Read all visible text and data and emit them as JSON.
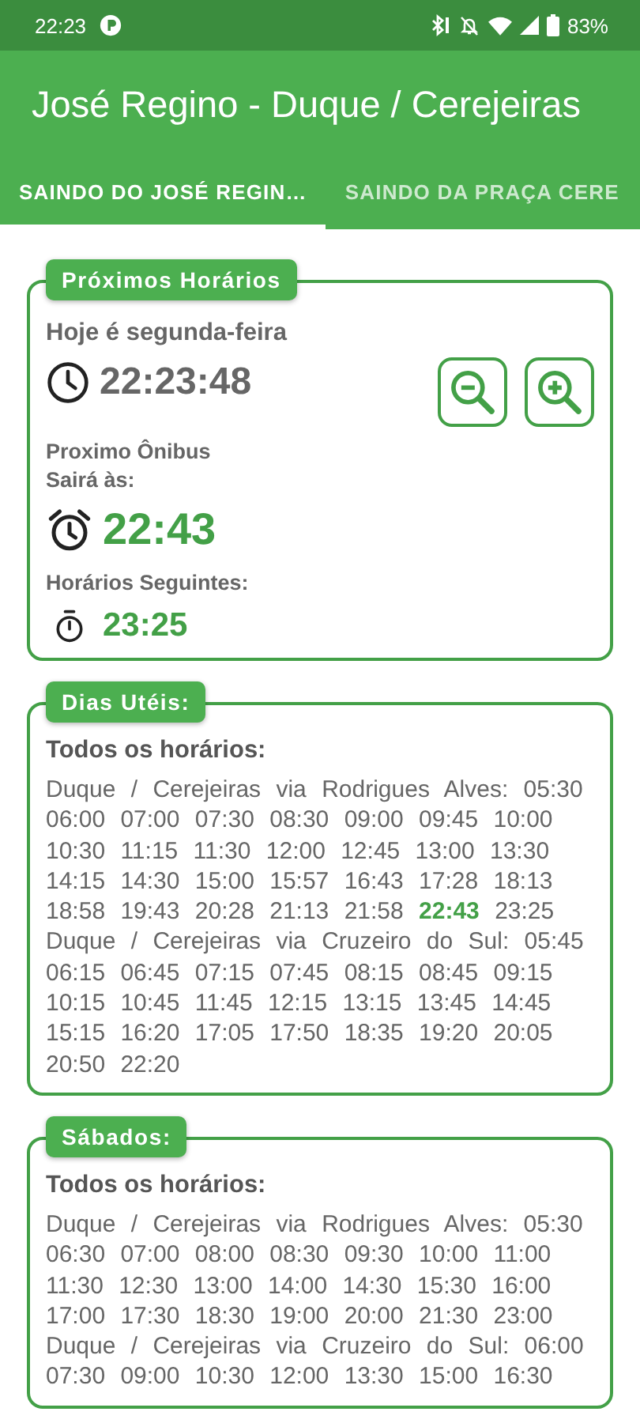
{
  "status_bar": {
    "time": "22:23",
    "battery": "83%"
  },
  "app_bar": {
    "title": "José Regino - Duque / Cerejeiras"
  },
  "tabs": [
    {
      "label": "SAINDO DO JOSÉ REGIN…",
      "selected": true
    },
    {
      "label": "SAINDO DA PRAÇA CERE",
      "selected": false
    }
  ],
  "next_card": {
    "legend": "Próximos Horários",
    "day": "Hoje é segunda-feira",
    "current_time": "22:23:48",
    "next_label": "Proximo Ônibus\nSairá às:",
    "next_time": "22:43",
    "following_label": "Horários Seguintes:",
    "following_times": [
      "23:25"
    ]
  },
  "schedules": [
    {
      "legend": "Dias Utéis:",
      "heading": "Todos os horários:",
      "routes": [
        "Duque / Cerejeiras via Rodrigues Alves: 05:30 06:00 07:00 07:30 08:30 09:00 09:45 10:00 10:30 11:15 11:30 12:00 12:45 13:00 13:30 14:15 14:30 15:00 15:57 16:43 17:28 18:13 18:58 19:43 20:28 21:13 21:58 **22:43** 23:25",
        "Duque / Cerejeiras via Cruzeiro do Sul: 05:45 06:15 06:45 07:15 07:45 08:15 08:45 09:15 10:15 10:45 11:45 12:15 13:15 13:45 14:45 15:15 16:20 17:05 17:50 18:35 19:20 20:05 20:50 22:20"
      ]
    },
    {
      "legend": "Sábados:",
      "heading": "Todos os horários:",
      "routes": [
        "Duque / Cerejeiras via Rodrigues Alves: 05:30 06:30 07:00 08:00 08:30 09:30 10:00 11:00 11:30 12:30 13:00 14:00 14:30 15:30 16:00 17:00 17:30 18:30 19:00 20:00 21:30 23:00",
        "Duque / Cerejeiras via Cruzeiro do Sul: 06:00 07:30 09:00 10:30 12:00 13:30 15:00 16:30"
      ]
    }
  ]
}
